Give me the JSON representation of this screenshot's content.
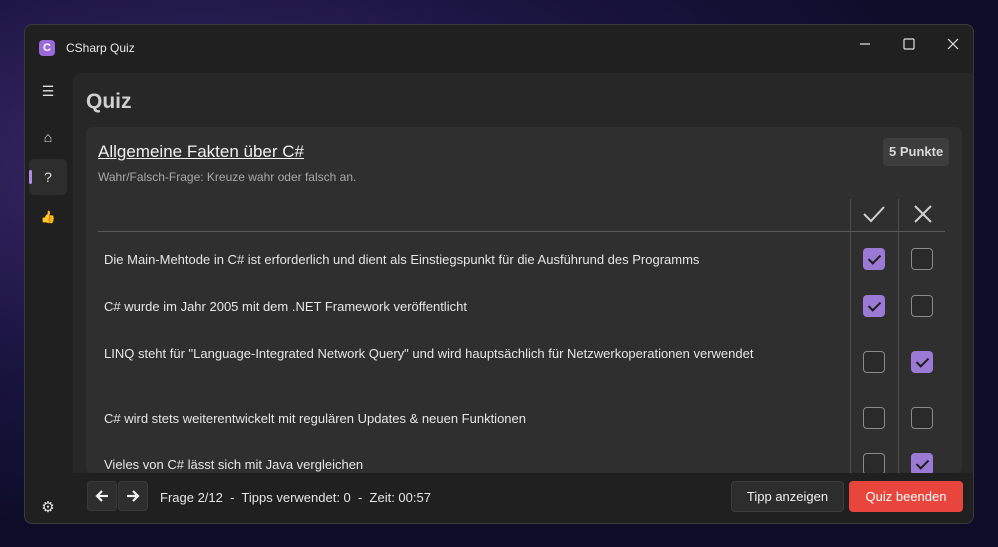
{
  "window": {
    "app_title": "CSharp Quiz",
    "app_icon_glyph": "C"
  },
  "sidebar": {
    "items": [
      {
        "name": "menu-icon",
        "glyph": "☰"
      },
      {
        "name": "home-icon",
        "glyph": "⌂"
      },
      {
        "name": "question-icon",
        "glyph": "?",
        "active": true
      },
      {
        "name": "hint-icon",
        "glyph": "👍"
      }
    ],
    "settings_glyph": "⚙"
  },
  "page": {
    "title": "Quiz"
  },
  "question": {
    "title": "Allgemeine Fakten über C#",
    "subtitle": "Wahr/Falsch-Frage: Kreuze wahr oder falsch an.",
    "points": "5 Punkte",
    "columns": [
      "true-check-icon",
      "false-x-icon"
    ],
    "statements": [
      {
        "text": "Die Main-Mehtode in C# ist erforderlich und dient als Einstiegspunkt für die Ausführund des Programms",
        "true_checked": true,
        "false_checked": false
      },
      {
        "text": "C# wurde im Jahr 2005 mit dem .NET Framework veröffentlicht",
        "true_checked": true,
        "false_checked": false
      },
      {
        "text": "LINQ steht für \"Language-Integrated Network Query\" und wird hauptsächlich für Netzwerkoperationen verwendet",
        "true_checked": false,
        "false_checked": true
      },
      {
        "text": "C# wird stets weiterentwickelt mit regulären Updates & neuen Funktionen",
        "true_checked": false,
        "false_checked": false
      },
      {
        "text": "Vieles von C# lässt sich mit Java vergleichen",
        "true_checked": false,
        "false_checked": true
      }
    ]
  },
  "footer": {
    "status": "Frage 2/12  -  Tipps verwendet: 0  -  Zeit: 00:57",
    "tip_button": "Tipp anzeigen",
    "end_button": "Quiz beenden"
  },
  "colors": {
    "accent": "#9b7ad6",
    "danger": "#e8453c"
  }
}
